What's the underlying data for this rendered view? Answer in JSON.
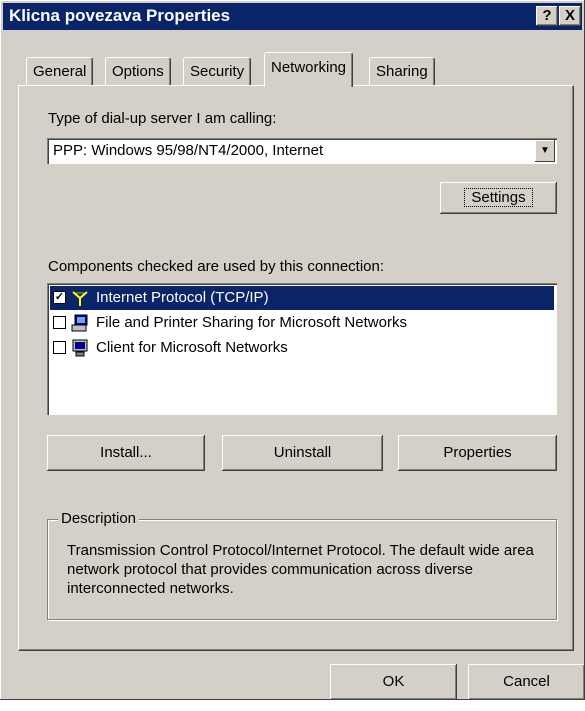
{
  "window": {
    "title": "Klicna povezava Properties",
    "help_label": "?",
    "close_label": "X"
  },
  "tabs": [
    {
      "label": "General"
    },
    {
      "label": "Options"
    },
    {
      "label": "Security"
    },
    {
      "label": "Networking",
      "active": true
    },
    {
      "label": "Sharing"
    }
  ],
  "server_type": {
    "label": "Type of dial-up server I am calling:",
    "selected": "PPP: Windows 95/98/NT4/2000, Internet"
  },
  "settings_button": "Settings",
  "components": {
    "label": "Components checked are used by this connection:",
    "items": [
      {
        "label": "Internet Protocol (TCP/IP)",
        "checked": true,
        "icon": "network-protocol-icon"
      },
      {
        "label": "File and Printer Sharing for Microsoft Networks",
        "checked": false,
        "icon": "network-service-icon"
      },
      {
        "label": "Client for Microsoft Networks",
        "checked": false,
        "icon": "network-client-icon"
      }
    ]
  },
  "actions": {
    "install": "Install...",
    "uninstall": "Uninstall",
    "properties": "Properties"
  },
  "description": {
    "title": "Description",
    "text": "Transmission Control Protocol/Internet Protocol. The default wide area network protocol that provides communication across diverse interconnected networks."
  },
  "footer": {
    "ok": "OK",
    "cancel": "Cancel"
  },
  "colors": {
    "titlebar": "#0a246a",
    "face": "#d4d0c8",
    "selection": "#0a246a"
  }
}
